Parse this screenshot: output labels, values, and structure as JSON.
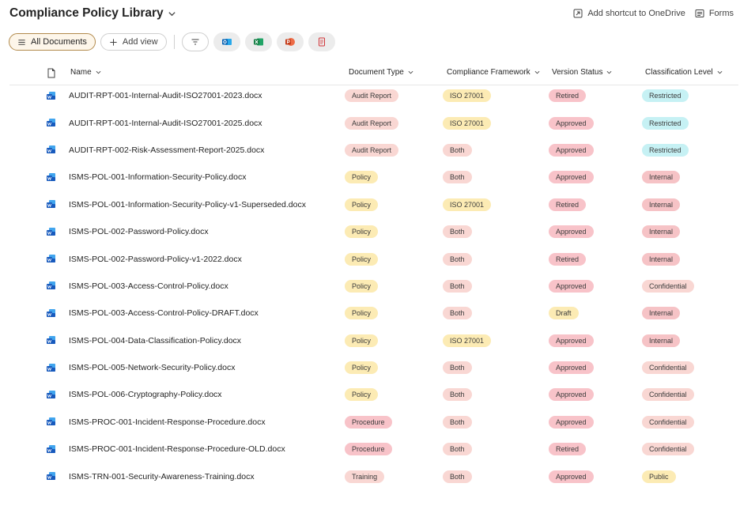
{
  "header": {
    "title": "Compliance Policy Library",
    "shortcut_label": "Add shortcut to OneDrive",
    "forms_label": "Forms"
  },
  "toolbar": {
    "view_label": "All Documents",
    "add_view_label": "Add view"
  },
  "columns": {
    "name": "Name",
    "doc_type": "Document Type",
    "framework": "Compliance Framework",
    "version": "Version Status",
    "classification": "Classification Level"
  },
  "badge_colors": {
    "Audit Report": "#f9d7d3",
    "Policy": "#fcebb4",
    "Procedure": "#f8c3c9",
    "Training": "#f9d7d3",
    "ISO 27001": "#fcebb4",
    "Both": "#f9d7d3",
    "Retired": "#f8c3c9",
    "Approved": "#f8c3c9",
    "Draft": "#fcebb4",
    "Restricted": "#c6f1f4",
    "Internal": "#f6c3c6",
    "Confidential": "#f9d7d3",
    "Public": "#fcebb4"
  },
  "rows": [
    {
      "name": "AUDIT-RPT-001-Internal-Audit-ISO27001-2023.docx",
      "type": "Audit Report",
      "framework": "ISO 27001",
      "version": "Retired",
      "classification": "Restricted"
    },
    {
      "name": "AUDIT-RPT-001-Internal-Audit-ISO27001-2025.docx",
      "type": "Audit Report",
      "framework": "ISO 27001",
      "version": "Approved",
      "classification": "Restricted"
    },
    {
      "name": "AUDIT-RPT-002-Risk-Assessment-Report-2025.docx",
      "type": "Audit Report",
      "framework": "Both",
      "version": "Approved",
      "classification": "Restricted"
    },
    {
      "name": "ISMS-POL-001-Information-Security-Policy.docx",
      "type": "Policy",
      "framework": "Both",
      "version": "Approved",
      "classification": "Internal"
    },
    {
      "name": "ISMS-POL-001-Information-Security-Policy-v1-Superseded.docx",
      "type": "Policy",
      "framework": "ISO 27001",
      "version": "Retired",
      "classification": "Internal"
    },
    {
      "name": "ISMS-POL-002-Password-Policy.docx",
      "type": "Policy",
      "framework": "Both",
      "version": "Approved",
      "classification": "Internal"
    },
    {
      "name": "ISMS-POL-002-Password-Policy-v1-2022.docx",
      "type": "Policy",
      "framework": "Both",
      "version": "Retired",
      "classification": "Internal"
    },
    {
      "name": "ISMS-POL-003-Access-Control-Policy.docx",
      "type": "Policy",
      "framework": "Both",
      "version": "Approved",
      "classification": "Confidential"
    },
    {
      "name": "ISMS-POL-003-Access-Control-Policy-DRAFT.docx",
      "type": "Policy",
      "framework": "Both",
      "version": "Draft",
      "classification": "Internal"
    },
    {
      "name": "ISMS-POL-004-Data-Classification-Policy.docx",
      "type": "Policy",
      "framework": "ISO 27001",
      "version": "Approved",
      "classification": "Internal"
    },
    {
      "name": "ISMS-POL-005-Network-Security-Policy.docx",
      "type": "Policy",
      "framework": "Both",
      "version": "Approved",
      "classification": "Confidential"
    },
    {
      "name": "ISMS-POL-006-Cryptography-Policy.docx",
      "type": "Policy",
      "framework": "Both",
      "version": "Approved",
      "classification": "Confidential"
    },
    {
      "name": "ISMS-PROC-001-Incident-Response-Procedure.docx",
      "type": "Procedure",
      "framework": "Both",
      "version": "Approved",
      "classification": "Confidential"
    },
    {
      "name": "ISMS-PROC-001-Incident-Response-Procedure-OLD.docx",
      "type": "Procedure",
      "framework": "Both",
      "version": "Retired",
      "classification": "Confidential"
    },
    {
      "name": "ISMS-TRN-001-Security-Awareness-Training.docx",
      "type": "Training",
      "framework": "Both",
      "version": "Approved",
      "classification": "Public"
    }
  ]
}
